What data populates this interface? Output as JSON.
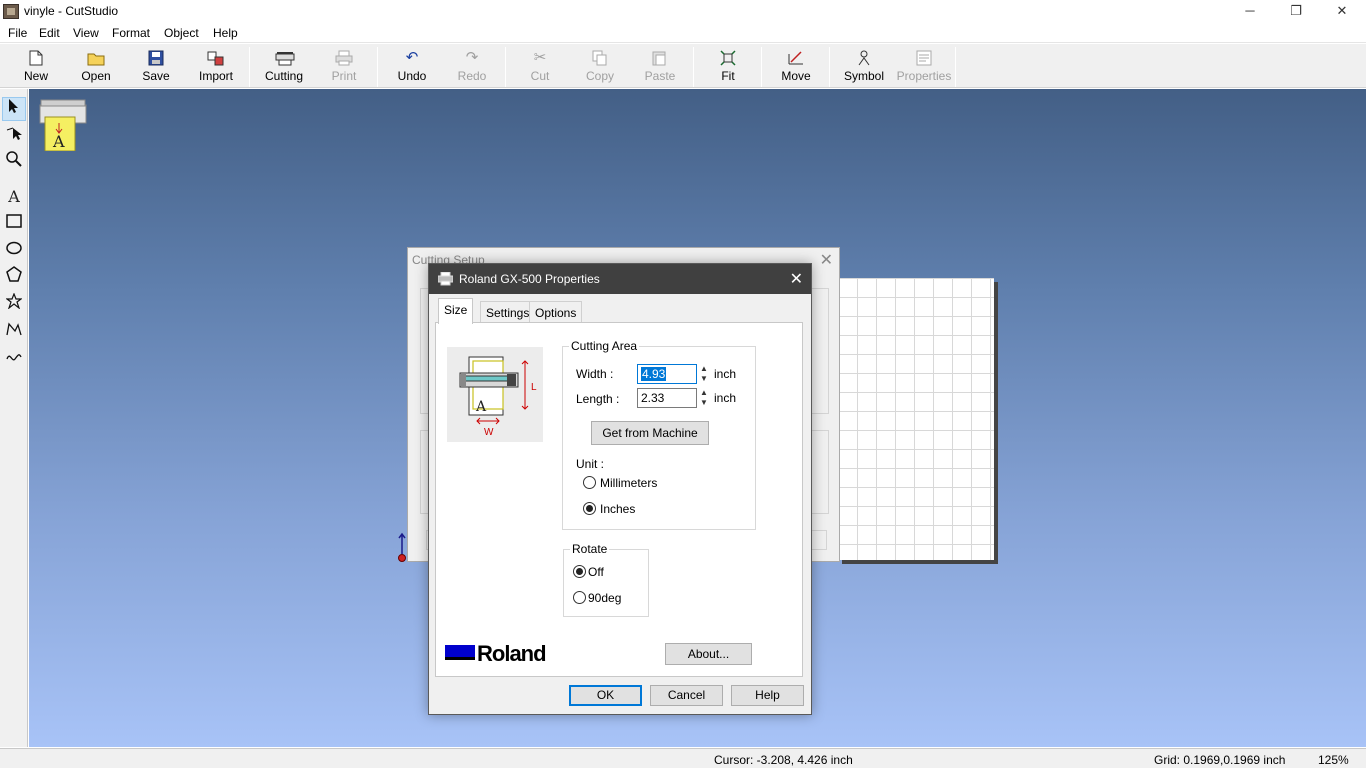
{
  "window": {
    "title": "vinyle - CutStudio",
    "minimize": "─",
    "restore": "❐",
    "close": "✕"
  },
  "menu": [
    "File",
    "Edit",
    "View",
    "Format",
    "Object",
    "Help"
  ],
  "toolbar": {
    "new": "New",
    "open": "Open",
    "save": "Save",
    "import": "Import",
    "cutting": "Cutting",
    "print": "Print",
    "undo": "Undo",
    "redo": "Redo",
    "cut": "Cut",
    "copy": "Copy",
    "paste": "Paste",
    "fit": "Fit",
    "move": "Move",
    "symbol": "Symbol",
    "properties": "Properties"
  },
  "tools": {
    "select": "select-arrow-icon",
    "edit_points": "edit-points-icon",
    "zoom": "zoom-icon",
    "text_glyph": "A",
    "rectangle": "rectangle-icon",
    "ellipse": "ellipse-icon",
    "polygon": "polygon-icon",
    "star": "star-icon",
    "polyline": "polyline-icon",
    "curve": "curve-icon"
  },
  "cutting_setup": {
    "title": "Cutting Setup",
    "close": "✕"
  },
  "properties_dialog": {
    "title": "Roland GX-500 Properties",
    "close": "✕",
    "tabs": [
      "Size",
      "Settings",
      "Options"
    ],
    "diagram": {
      "label_l": "L",
      "label_w": "W",
      "label_a": "A"
    },
    "cutting_area": {
      "label": "Cutting Area",
      "width_label": "Width :",
      "width_value": "4.93",
      "width_unit": "inch",
      "length_label": "Length :",
      "length_value": "2.33",
      "length_unit": "inch",
      "get_from_machine": "Get from Machine",
      "unit_label": "Unit :",
      "unit_options": [
        "Millimeters",
        "Inches"
      ],
      "unit_selected": "Inches"
    },
    "rotate": {
      "label": "Rotate",
      "options": [
        "Off",
        "90deg"
      ],
      "selected": "Off"
    },
    "brand": "Roland",
    "about": "About...",
    "ok": "OK",
    "cancel": "Cancel",
    "help": "Help"
  },
  "status": {
    "cursor": "Cursor: -3.208, 4.426 inch",
    "grid": "Grid: 0.1969,0.1969 inch",
    "zoom": "125%"
  },
  "colors": {
    "accent": "#0078d7",
    "dialog_titlebar": "#404040",
    "brand_blue": "#0000cc"
  }
}
